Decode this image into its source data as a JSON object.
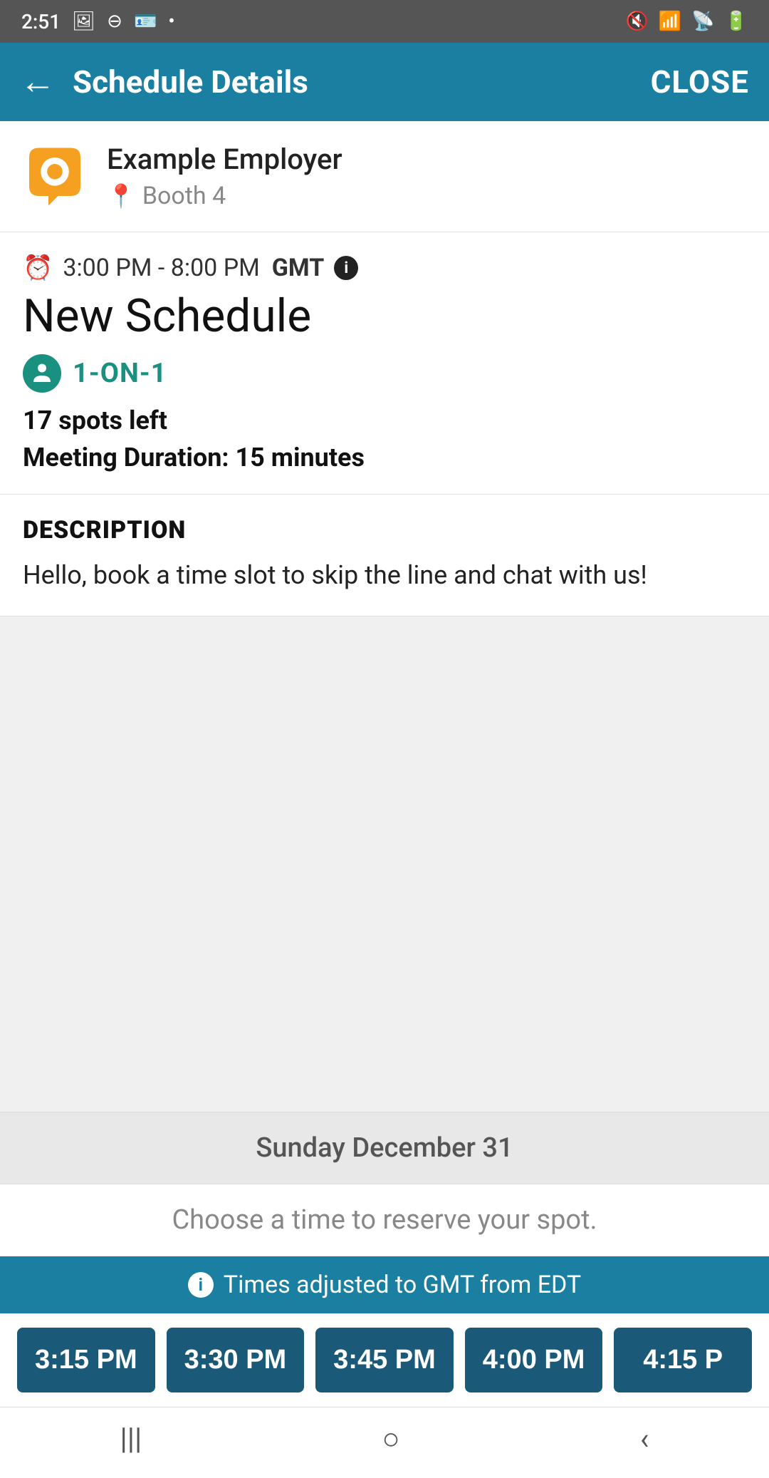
{
  "statusBar": {
    "time": "2:51",
    "icons": [
      "image",
      "minus-circle",
      "id",
      "dot",
      "mute",
      "wifi",
      "signal",
      "battery"
    ]
  },
  "navBar": {
    "backIcon": "←",
    "title": "Schedule Details",
    "closeLabel": "CLOSE"
  },
  "employer": {
    "name": "Example Employer",
    "boothLabel": "Booth 4",
    "locationIcon": "📍"
  },
  "schedule": {
    "timeRange": "3:00 PM - 8:00 PM",
    "timezone": "GMT",
    "title": "New Schedule",
    "typeLabel": "1-ON-1",
    "spotsLeft": "17 spots left",
    "duration": "Meeting Duration: 15 minutes"
  },
  "description": {
    "heading": "DESCRIPTION",
    "text": "Hello, book a time slot to skip the line and chat with us!"
  },
  "timePicker": {
    "dateLabel": "Sunday December 31",
    "chooseLabel": "Choose a time to reserve your spot.",
    "bannerText": "Times adjusted to GMT from EDT",
    "slots": [
      "3:15 PM",
      "3:30 PM",
      "3:45 PM",
      "4:00 PM",
      "4:15 P"
    ]
  },
  "bottomNav": {
    "icons": [
      "|||",
      "○",
      "<"
    ]
  }
}
